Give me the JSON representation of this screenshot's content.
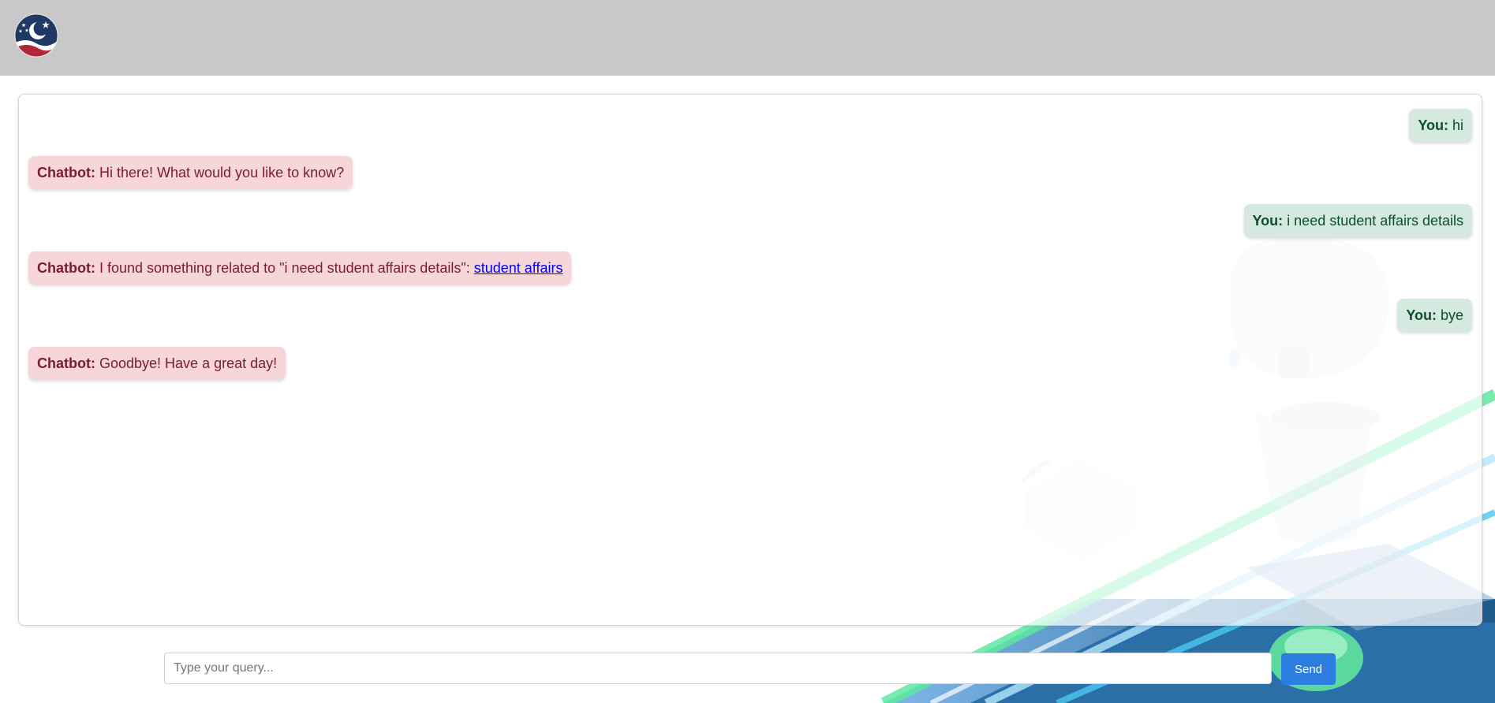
{
  "header": {
    "logo_icon": "crescent-stars-logo-icon"
  },
  "colors": {
    "header_bg": "#c8c8c8",
    "user_bubble": "#d4e9df",
    "user_text": "#0f4d2e",
    "bot_bubble": "#f6d6d9",
    "bot_text": "#7a1d2a",
    "send_button": "#2b7de0"
  },
  "messages": [
    {
      "sender": "user",
      "who": "You:",
      "text": " hi"
    },
    {
      "sender": "bot",
      "who": "Chatbot:",
      "text": " Hi there! What would you like to know?"
    },
    {
      "sender": "user",
      "who": "You:",
      "text": " i need student affairs details"
    },
    {
      "sender": "bot",
      "who": "Chatbot:",
      "text": " I found something related to \"i need student affairs details\": ",
      "link": "student affairs"
    },
    {
      "sender": "user",
      "who": "You:",
      "text": " bye"
    },
    {
      "sender": "bot",
      "who": "Chatbot:",
      "text": " Goodbye! Have a great day!"
    }
  ],
  "input": {
    "placeholder": "Type your query...",
    "value": ""
  },
  "send_label": "Send"
}
